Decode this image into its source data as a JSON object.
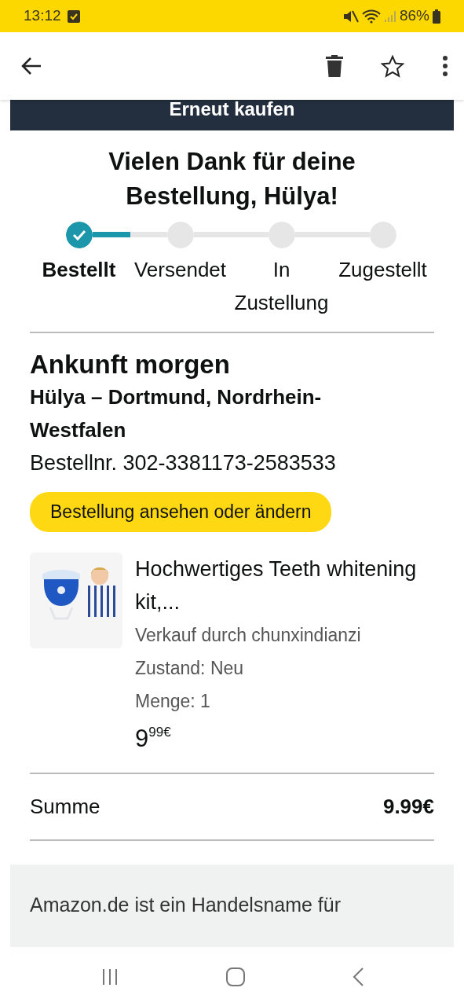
{
  "status_bar": {
    "time": "13:12",
    "battery": "86%"
  },
  "buy_again": {
    "label": "Erneut kaufen"
  },
  "heading": "Vielen Dank für deine Bestellung, Hülya!",
  "steps": [
    {
      "label": "Bestellt",
      "done": true
    },
    {
      "label": "Versendet",
      "done": false
    },
    {
      "label": "In Zustellung",
      "done": false
    },
    {
      "label": "Zugestellt",
      "done": false
    }
  ],
  "progress": {
    "level": 0.5
  },
  "delivery": {
    "title": "Ankunft morgen",
    "address": "Hülya – Dortmund, Nordrhein-Westfalen",
    "order_number": "Bestellnr. 302-3381173-2583533",
    "button": "Bestellung ansehen oder ändern"
  },
  "item": {
    "kind": "picture",
    "title": "Hochwertiges Teeth whitening kit,...",
    "seller": "Verkauf durch chunxindianzi",
    "condition": "Zustand: Neu",
    "quantity": "Menge: 1",
    "price_whole": "9",
    "price_fraction": "99€"
  },
  "total": {
    "label": "Summe",
    "value": "9.99€"
  },
  "footer": "Amazon.de ist ein Handelsname für"
}
